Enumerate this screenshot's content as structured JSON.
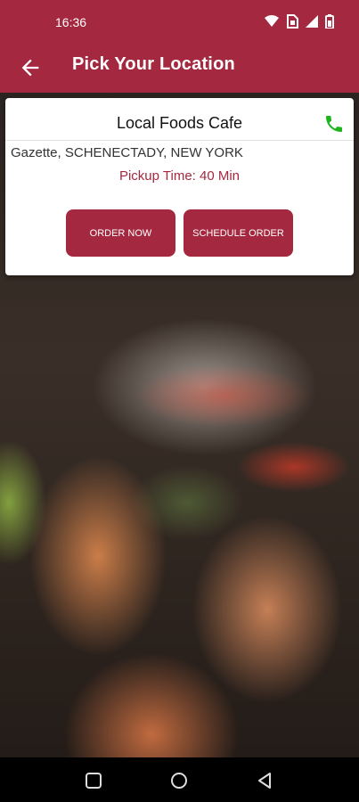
{
  "status_bar": {
    "time": "16:36"
  },
  "app_bar": {
    "title": "Pick Your Location"
  },
  "location_card": {
    "name": "Local Foods Cafe",
    "address": "Gazette, SCHENECTADY, NEW YORK",
    "pickup_time": "Pickup Time: 40 Min",
    "order_now_label": "ORDER NOW",
    "schedule_order_label": "SCHEDULE ORDER"
  },
  "colors": {
    "brand": "#a4283f",
    "phone_icon": "#1db51d"
  },
  "icons": [
    "wifi-icon",
    "sim-icon",
    "signal-icon",
    "battery-icon",
    "back-arrow-icon",
    "phone-icon",
    "recents-icon",
    "home-icon",
    "back-icon"
  ]
}
